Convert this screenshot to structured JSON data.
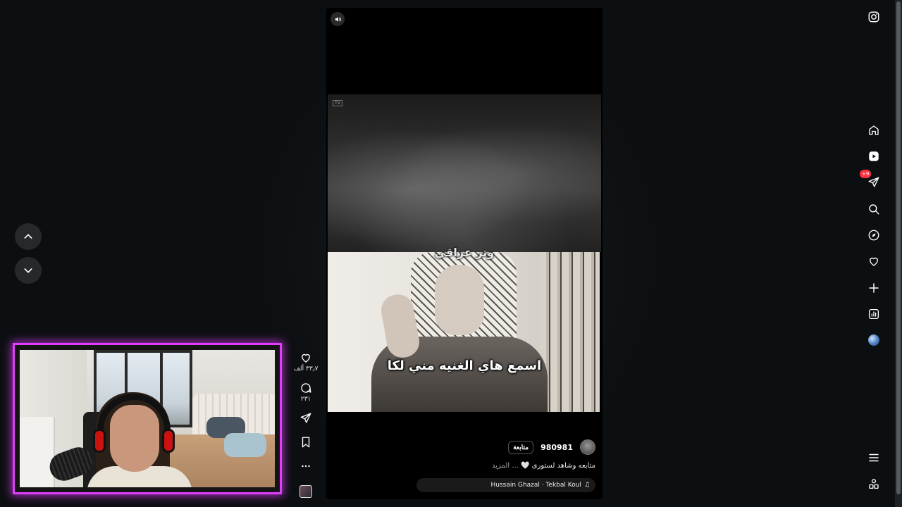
{
  "reel": {
    "mid_caption": "وتر عراقي",
    "main_caption": "اسمع هاي الغنيه مني لكا",
    "corner_tag": "TV",
    "username": "980981",
    "follow_label": "متابعة",
    "description_text": "متابعه وشاهد لستورى",
    "description_heart": "🤍",
    "description_more": "... المزيد",
    "audio_title": "Hussain Ghazal · Tekbal Koul",
    "audio_icon": "♫"
  },
  "actions": {
    "likes_count": "٣٣٫٧ ألف",
    "comments_count": "٢٣١"
  },
  "rail": {
    "messages_badge": "+9",
    "items": [
      "instagram-logo",
      "home",
      "reels",
      "messages",
      "search",
      "explore",
      "notifications",
      "create",
      "dashboard",
      "profile",
      "more",
      "also-from-meta"
    ]
  },
  "nav": {
    "items": [
      "previous-reel",
      "next-reel"
    ]
  },
  "colors": {
    "background": "#0c0f11",
    "webcam_border": "#e23cff",
    "badge": "#ff3040",
    "reel_bg": "#000000"
  }
}
